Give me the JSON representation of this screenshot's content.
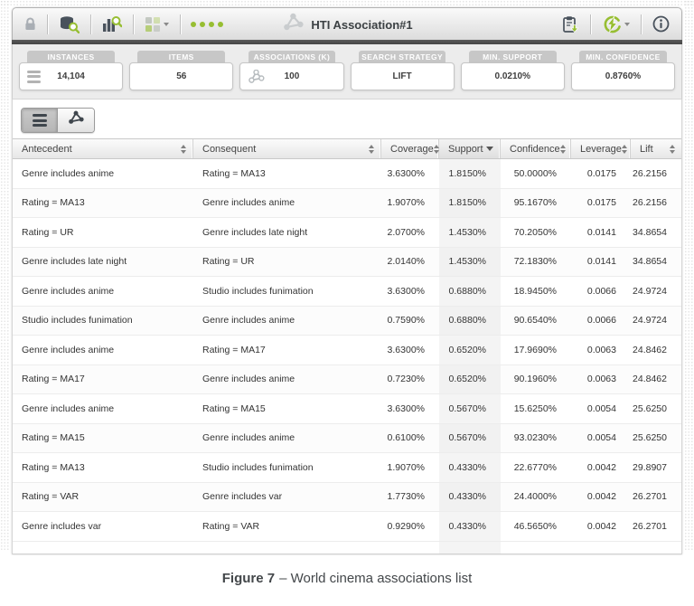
{
  "toolbar": {
    "title": "HTI Association#1",
    "left_icons": [
      "lock-icon",
      "data-search-icon",
      "chart-search-icon",
      "tiles-dropdown-icon",
      "status-dots"
    ],
    "right_icons": [
      "export-report-icon",
      "run-icon",
      "info-icon"
    ]
  },
  "stats": {
    "cards": [
      {
        "label": "INSTANCES",
        "value": "14,104",
        "icon": "menu-icon"
      },
      {
        "label": "ITEMS",
        "value": "56",
        "icon": null
      },
      {
        "label": "ASSOCIATIONS (K)",
        "value": "100",
        "icon": "network-icon"
      },
      {
        "label": "SEARCH STRATEGY",
        "value": "LIFT",
        "icon": null
      },
      {
        "label": "MIN. SUPPORT",
        "value": "0.0210%",
        "icon": null
      },
      {
        "label": "MIN. CONFIDENCE",
        "value": "0.8760%",
        "icon": null
      }
    ]
  },
  "tabs": [
    {
      "name": "list-view",
      "icon": "list-icon",
      "active": true
    },
    {
      "name": "network-view",
      "icon": "network-icon",
      "active": false
    }
  ],
  "table": {
    "columns": [
      {
        "label": "Antecedent",
        "sort": "both"
      },
      {
        "label": "Consequent",
        "sort": "both"
      },
      {
        "label": "Coverage",
        "sort": "both"
      },
      {
        "label": "Support",
        "sort": "desc"
      },
      {
        "label": "Confidence",
        "sort": "both"
      },
      {
        "label": "Leverage",
        "sort": "both"
      },
      {
        "label": "Lift",
        "sort": "both"
      }
    ],
    "rows": [
      [
        "Genre includes anime",
        "Rating = MA13",
        "3.6300%",
        "1.8150%",
        "50.0000%",
        "0.0175",
        "26.2156"
      ],
      [
        "Rating = MA13",
        "Genre includes anime",
        "1.9070%",
        "1.8150%",
        "95.1670%",
        "0.0175",
        "26.2156"
      ],
      [
        "Rating = UR",
        "Genre includes late night",
        "2.0700%",
        "1.4530%",
        "70.2050%",
        "0.0141",
        "34.8654"
      ],
      [
        "Genre includes late night",
        "Rating = UR",
        "2.0140%",
        "1.4530%",
        "72.1830%",
        "0.0141",
        "34.8654"
      ],
      [
        "Genre includes anime",
        "Studio includes funimation",
        "3.6300%",
        "0.6880%",
        "18.9450%",
        "0.0066",
        "24.9724"
      ],
      [
        "Studio includes funimation",
        "Genre includes anime",
        "0.7590%",
        "0.6880%",
        "90.6540%",
        "0.0066",
        "24.9724"
      ],
      [
        "Genre includes anime",
        "Rating = MA17",
        "3.6300%",
        "0.6520%",
        "17.9690%",
        "0.0063",
        "24.8462"
      ],
      [
        "Rating = MA17",
        "Genre includes anime",
        "0.7230%",
        "0.6520%",
        "90.1960%",
        "0.0063",
        "24.8462"
      ],
      [
        "Genre includes anime",
        "Rating = MA15",
        "3.6300%",
        "0.5670%",
        "15.6250%",
        "0.0054",
        "25.6250"
      ],
      [
        "Rating = MA15",
        "Genre includes anime",
        "0.6100%",
        "0.5670%",
        "93.0230%",
        "0.0054",
        "25.6250"
      ],
      [
        "Rating = MA13",
        "Studio includes funimation",
        "1.9070%",
        "0.4330%",
        "22.6770%",
        "0.0042",
        "29.8907"
      ],
      [
        "Rating = VAR",
        "Genre includes var",
        "1.7730%",
        "0.4330%",
        "24.4000%",
        "0.0042",
        "26.2701"
      ],
      [
        "Genre includes var",
        "Rating = VAR",
        "0.9290%",
        "0.4330%",
        "46.5650%",
        "0.0042",
        "26.2701"
      ]
    ]
  },
  "caption": {
    "figure_label": "Figure 7",
    "text": "– World cinema associations list"
  },
  "colors": {
    "accent_green": "#97be32",
    "icon_gray": "#49525c",
    "toolbar_strip": "#4b4b4b"
  }
}
